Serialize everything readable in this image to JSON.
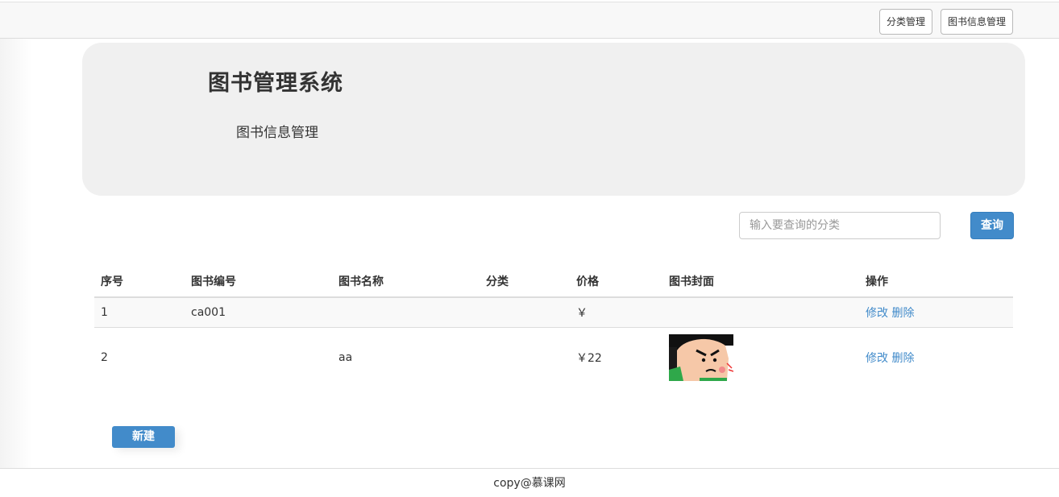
{
  "nav": {
    "category_label": "分类管理",
    "book_info_label": "图书信息管理"
  },
  "jumbotron": {
    "title": "图书管理系统",
    "subtitle": "图书信息管理"
  },
  "search": {
    "placeholder": "输入要查询的分类",
    "value": "",
    "button_label": "查询"
  },
  "table": {
    "headers": [
      "序号",
      "图书编号",
      "图书名称",
      "分类",
      "价格",
      "图书封面",
      "操作"
    ],
    "rows": [
      {
        "index": "1",
        "code": "ca001",
        "name": "",
        "category": "",
        "price": "￥",
        "cover": "",
        "edit": "修改",
        "delete": "删除"
      },
      {
        "index": "2",
        "code": "",
        "name": "aa",
        "category": "",
        "price": "￥22",
        "cover": "cartoon-face-image",
        "edit": "修改",
        "delete": "删除"
      }
    ]
  },
  "actions": {
    "new_label": "新建"
  },
  "footer": {
    "text": "copy@慕课网"
  },
  "colors": {
    "primary": "#428bca",
    "jumbotron_bg": "#f0f0f0",
    "navbar_bg": "#f8f8f8"
  }
}
